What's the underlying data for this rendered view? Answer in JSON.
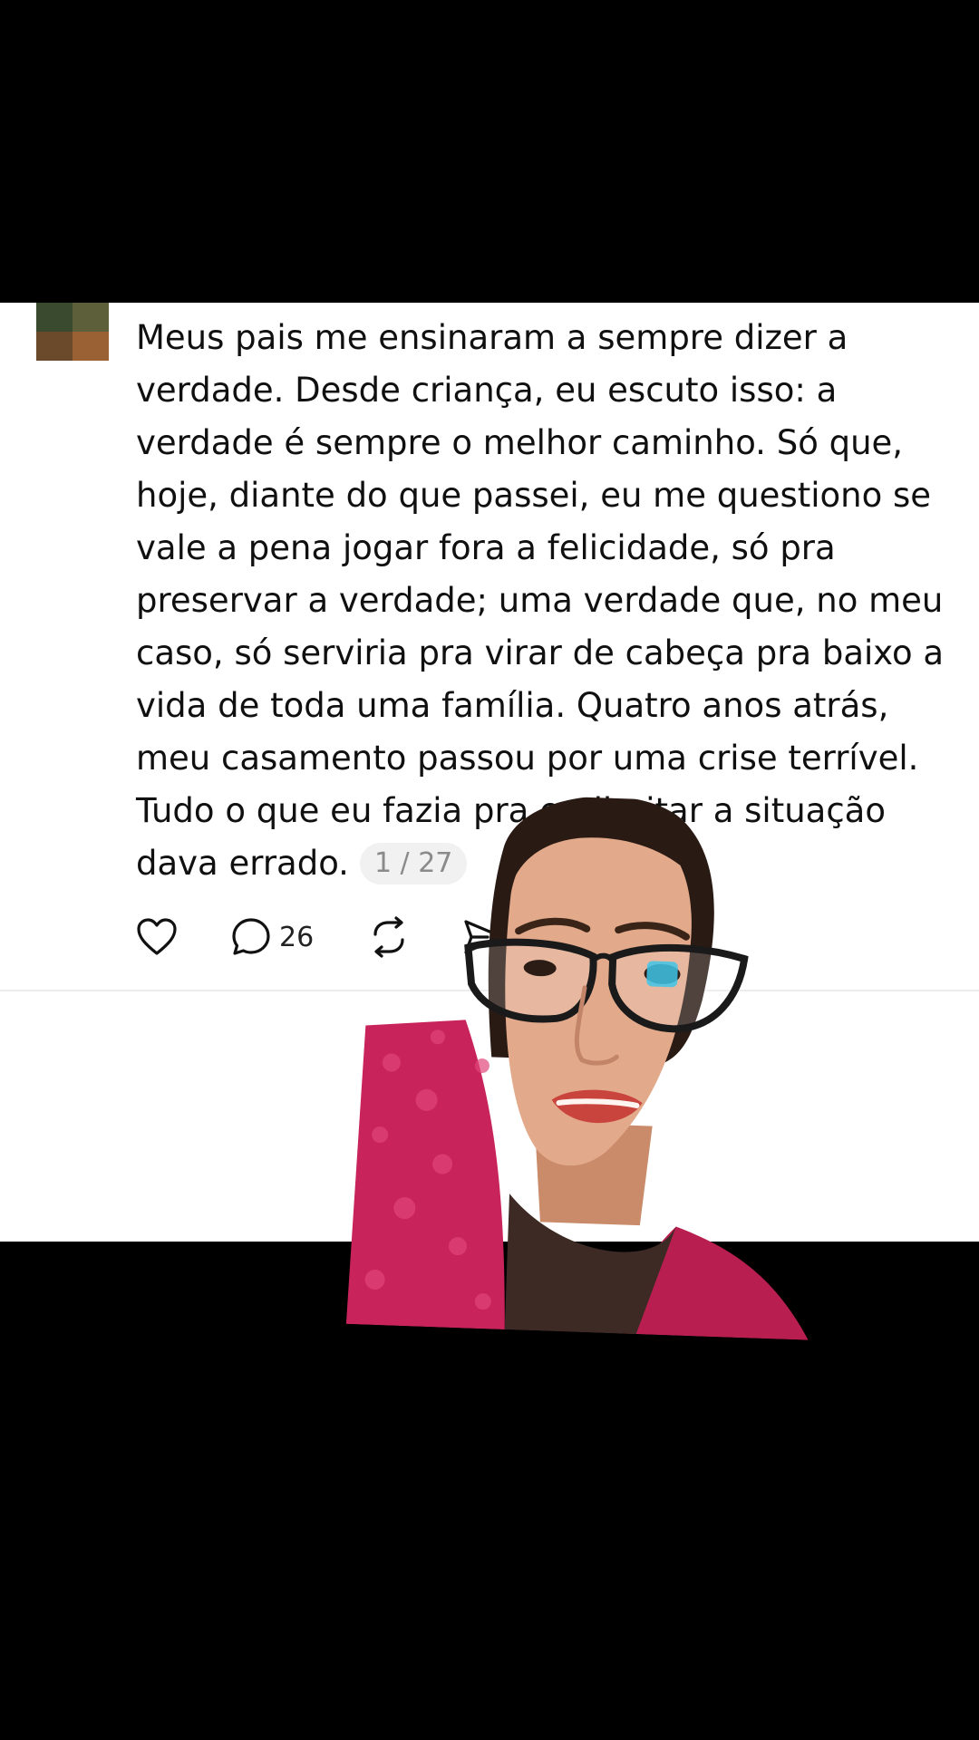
{
  "post": {
    "text": "Meus pais me ensinaram a sempre dizer a verdade. Desde criança, eu escuto isso: a verdade é sempre o melhor caminho. Só que, hoje, diante do que passei, eu me questiono se vale a pena jogar fora a felicidade, só pra preservar a verdade; uma verdade que, no meu caso, só serviria pra virar de cabeça pra baixo a vida de toda uma família. Quatro anos atrás, meu casamento passou por uma crise terrível. Tudo o que eu fazia pra endireitar a situação dava errado.",
    "page_counter": "1 / 27"
  },
  "actions": {
    "like_icon": "heart-icon",
    "comment_icon": "speech-bubble-icon",
    "comment_count": "26",
    "repost_icon": "repost-icon",
    "share_icon": "send-icon"
  },
  "colors": {
    "background": "#000000",
    "card": "#ffffff",
    "text": "#101010",
    "counter_bg": "#f1f1f1",
    "counter_text": "#8a8a8a",
    "sweater": "#c8235a"
  }
}
